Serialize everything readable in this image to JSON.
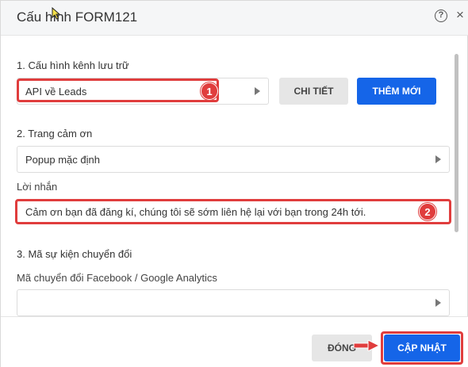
{
  "dialog": {
    "title": "Cấu hình FORM121",
    "help_icon_glyph": "?",
    "close_icon_glyph": "×"
  },
  "storage": {
    "section_title": "1. Cấu hình kênh lưu trữ",
    "selected_value": "API về Leads",
    "detail_button": "CHI TIẾT",
    "add_button": "THÊM MỚI",
    "marker": "1"
  },
  "thankyou": {
    "section_title": "2. Trang cảm ơn",
    "selected_value": "Popup mặc định",
    "message_label": "Lời nhắn",
    "message_value": "Cảm ơn bạn đã đăng kí, chúng tôi sẽ sớm liên hệ lại với bạn trong 24h tới.",
    "marker": "2"
  },
  "conversion": {
    "section_title": "3. Mã sự kiện chuyển đổi",
    "field_label": "Mã chuyển đổi Facebook / Google Analytics"
  },
  "footer": {
    "close_button": "ĐÓNG",
    "update_button": "CẬP NHẬT"
  },
  "colors": {
    "primary": "#1565e8",
    "highlight": "#e03d3d",
    "secondary_button": "#e6e6e6"
  }
}
